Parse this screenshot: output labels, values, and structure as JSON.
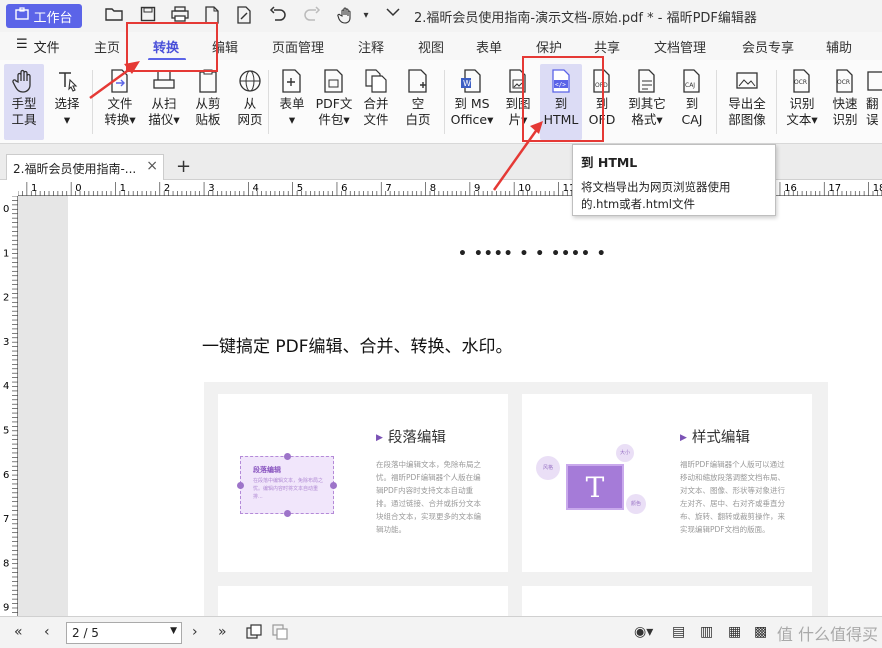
{
  "titlebar": {
    "workbench_label": "工作台",
    "doc_title": "2.福昕会员使用指南-演示文档-原始.pdf * - 福昕PDF编辑器"
  },
  "menu": {
    "file": "文件",
    "tabs": [
      "主页",
      "转换",
      "编辑",
      "页面管理",
      "注释",
      "视图",
      "表单",
      "保护",
      "共享",
      "文档管理",
      "会员专享",
      "辅助"
    ],
    "active": "转换"
  },
  "ribbon": {
    "buttons": [
      {
        "line1": "手型",
        "line2": "工具"
      },
      {
        "line1": "选择",
        "line2": "▾"
      },
      {
        "line1": "文件",
        "line2": "转换▾"
      },
      {
        "line1": "从扫",
        "line2": "描仪▾"
      },
      {
        "line1": "从剪",
        "line2": "贴板"
      },
      {
        "line1": "从",
        "line2": "网页"
      },
      {
        "line1": "表单",
        "line2": "▾"
      },
      {
        "line1": "PDF文",
        "line2": "件包▾"
      },
      {
        "line1": "合并",
        "line2": "文件"
      },
      {
        "line1": "空",
        "line2": "白页"
      },
      {
        "line1": "到 MS",
        "line2": "Office▾"
      },
      {
        "line1": "到图",
        "line2": "片▾"
      },
      {
        "line1": "到",
        "line2": "HTML"
      },
      {
        "line1": "到",
        "line2": "OFD"
      },
      {
        "line1": "到其它",
        "line2": "格式▾"
      },
      {
        "line1": "到",
        "line2": "CAJ"
      },
      {
        "line1": "导出全",
        "line2": "部图像"
      },
      {
        "line1": "识别",
        "line2": "文本▾"
      },
      {
        "line1": "快速",
        "line2": "识别"
      },
      {
        "line1": "翻",
        "line2": "误"
      }
    ]
  },
  "doctab": {
    "label": "2.福昕会员使用指南-...",
    "close": "×",
    "new": "+"
  },
  "tooltip": {
    "title": "到 HTML",
    "desc": "将文档导出为网页浏览器使用的.htm或者.html文件"
  },
  "ruler": {
    "h_labels": [
      "1",
      "0",
      "1",
      "2",
      "3",
      "4",
      "5",
      "6",
      "7",
      "8",
      "9",
      "10",
      "11",
      "12",
      "13",
      "14",
      "15",
      "16",
      "17",
      "18"
    ],
    "v_labels": [
      "0",
      "1",
      "2",
      "3",
      "4",
      "5",
      "6",
      "7",
      "8",
      "9"
    ]
  },
  "document": {
    "dots": "• •••• • • •••• •",
    "heading": "一键搞定 PDF编辑、合并、转换、水印。",
    "cards": [
      {
        "title": "段落编辑",
        "body": "在段落中编辑文本，免除布局之忧。福昕PDF编辑器个人版在编辑PDF内容时支持文本自动重排。通过链接、合并或拆分文本块组合文本，实现更多的文本编辑功能。",
        "mock_title": "段落编辑",
        "mock_text": "在段落中编辑文本，免除布局之忧。编辑内容时将文本自动重排..."
      },
      {
        "title": "样式编辑",
        "body": "福昕PDF编辑器个人版可以通过移动和缩放段落调整文档布局、对文本、图像、形状等对象进行左对齐、居中、右对齐或垂直分布、旋转、翻转或裁剪操作，来实现编辑PDF文档的版面。",
        "mock_letter": "T",
        "mock_tags": [
          "风格",
          "大小",
          "颜色"
        ]
      }
    ]
  },
  "statusbar": {
    "page_value": "2 / 5",
    "watermark": "值 什么值得买"
  },
  "colors": {
    "accent": "#5b64e8",
    "annotation_red": "#e53935",
    "card_purple": "#a57bd8"
  }
}
